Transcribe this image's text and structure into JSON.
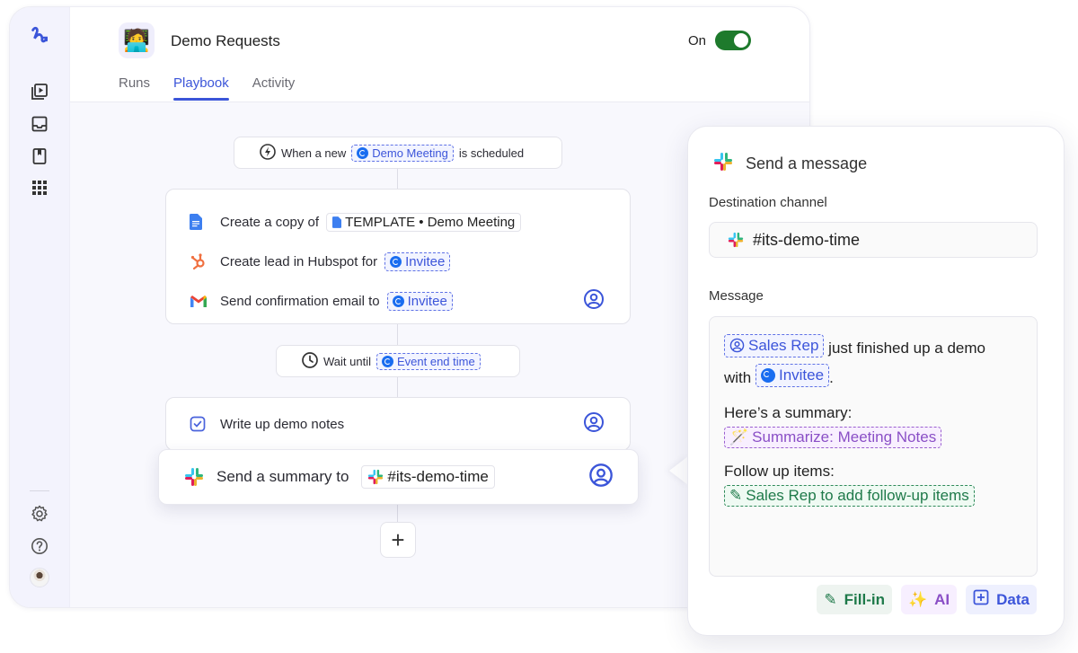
{
  "sidebar": {
    "logo": "workflow-logo",
    "items": [
      {
        "name": "runs-icon"
      },
      {
        "name": "inbox-icon"
      },
      {
        "name": "book-icon"
      },
      {
        "name": "apps-grid-icon"
      }
    ],
    "bottom": [
      {
        "name": "settings-icon"
      },
      {
        "name": "help-icon"
      },
      {
        "name": "user-avatar"
      }
    ]
  },
  "header": {
    "app_icon": "🧑‍💻",
    "title": "Demo Requests",
    "toggle_label": "On",
    "toggle_on": true,
    "tabs": [
      {
        "label": "Runs",
        "active": false
      },
      {
        "label": "Playbook",
        "active": true
      },
      {
        "label": "Activity",
        "active": false
      }
    ]
  },
  "flow": {
    "trigger": {
      "prefix": "When a new",
      "token": "Demo Meeting",
      "suffix": "is scheduled"
    },
    "block1": [
      {
        "icon": "google-docs-icon",
        "text": "Create a copy of",
        "token": "TEMPLATE • Demo Meeting"
      },
      {
        "icon": "hubspot-icon",
        "text": "Create lead in Hubspot for",
        "token": "Invitee"
      },
      {
        "icon": "gmail-icon",
        "text": "Send confirmation email to",
        "token": "Invitee",
        "assignee": true
      }
    ],
    "wait": {
      "prefix": "Wait until",
      "token": "Event end time"
    },
    "block2": {
      "icon": "checkbox-icon",
      "text": "Write up demo notes",
      "assignee": true
    },
    "block3": {
      "icon": "slack-icon",
      "text": "Send a summary to",
      "token": "#its-demo-time",
      "assignee": true
    },
    "add_label": "+"
  },
  "panel": {
    "title": "Send a message",
    "dest_label": "Destination channel",
    "dest_value": "#its-demo-time",
    "message_label": "Message",
    "message": {
      "token_sales_rep": "Sales Rep",
      "line1_rest": "just finished up a demo",
      "with": "with",
      "token_invitee": "Invitee",
      "period": ".",
      "summary_label": "Here’s a summary:",
      "token_summary": "Summarize: Meeting Notes",
      "followup_label": "Follow up items:",
      "token_followup": "Sales Rep to add follow-up items"
    },
    "actions": [
      {
        "label": "Fill-in",
        "icon": "fill-in-icon"
      },
      {
        "label": "AI",
        "icon": "magic-wand-icon"
      },
      {
        "label": "Data",
        "icon": "plus-box-icon"
      }
    ]
  },
  "colors": {
    "accent": "#3b55d9",
    "toggle_on": "#1e7a2c",
    "ai": "#8a4fc6",
    "fill_in": "#1f7a4a"
  }
}
